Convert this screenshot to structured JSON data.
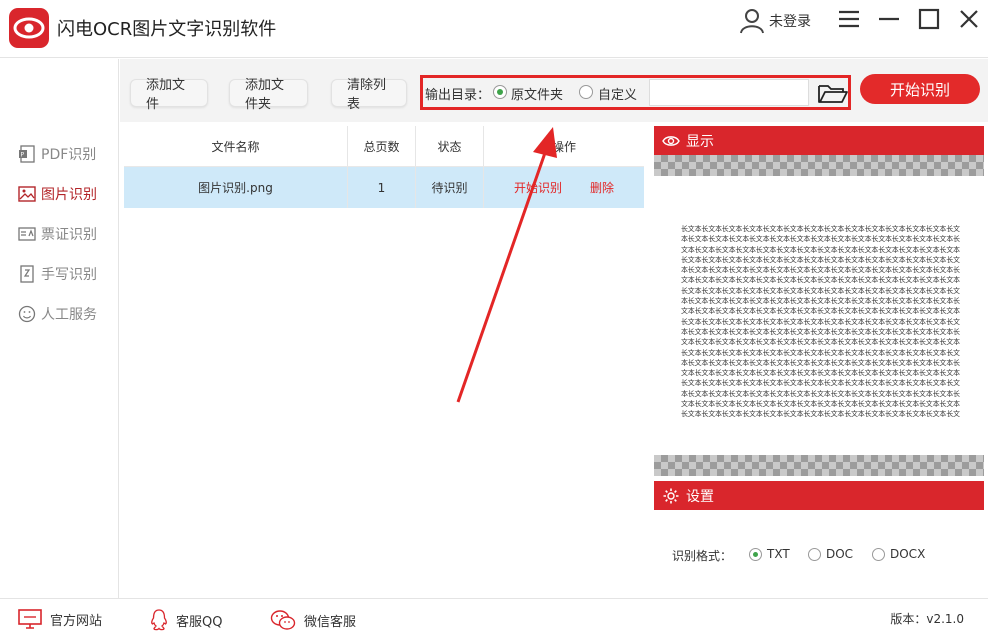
{
  "app": {
    "title": "闪电OCR图片文字识别软件",
    "user_label": "未登录"
  },
  "sidebar": {
    "items": [
      {
        "label": "PDF识别",
        "icon": "pdf-icon",
        "active": false
      },
      {
        "label": "图片识别",
        "icon": "image-icon",
        "active": true
      },
      {
        "label": "票证识别",
        "icon": "ticket-icon",
        "active": false
      },
      {
        "label": "手写识别",
        "icon": "handwrite-icon",
        "active": false
      },
      {
        "label": "人工服务",
        "icon": "smiley-icon",
        "active": false
      }
    ]
  },
  "toolbar": {
    "add_file": "添加文件",
    "add_folder": "添加文件夹",
    "clear_list": "清除列表",
    "output_label": "输出目录：",
    "option_source": "原文件夹",
    "option_custom": "自定义",
    "path_value": "",
    "start": "开始识别"
  },
  "table": {
    "headers": [
      "文件名称",
      "总页数",
      "状态",
      "操作"
    ],
    "rows": [
      {
        "name": "图片识别.png",
        "pages": "1",
        "status": "待识别",
        "action_start": "开始识别",
        "action_delete": "删除"
      }
    ]
  },
  "preview": {
    "title": "显示",
    "text": "长文本长文本长文本长文本长文本长文本长文本长文本长文本长文本长文本长文本长文本长文本长文本长文本长文本长文本长文本长文本长文本长文本长文本长文本长文本长文本长文本长文本长文本长文本长文本长文本长文本长文本长文本长文本长文本长文本长文本长文本长文本长文本长文本长文本长文本长文本长文本长文本长文本长文本长文本长文本长文本长文本长文本长文本长文本长文本长文本长文本长文本长文本长文本长文本长文本长文本长文本长文本长文本长文本长文本长文本长文本长文本长文本长文本长文本长文本长文本长文本长文本长文本长文本长文本长文本长文本长文本长文本长文本长文本长文本长文本长文本长文本长文本长文本长文本长文本长文本长文本长文本长文本长文本长文本长文本长文本长文本长文本长文本长文本长文本长文本长文本长文本长文本长文本长文本长文本长文本长文本长文本长文本长文本长文本长文本长文本长文本长文本长文本长文本长文本长文本长文本长文本长文本长文本长文本长文本长文本长文本长文本长文本长文本长文本长文本长文本长文本长文本长文本长文本长文本长文本长文本长文本长文本长文本长文本长文本长文本长文本长文本长文本长文本长文本长文本长文本长文本长文本长文本长文本长文本长文本长文本长文本长文本长文本长文本长文本长文本长文本长文本长文本长文本长文本长文本长文本长文本长文本长文本长文本长文本长文本长文本长文本长文本长文本长文本长文本长文本长文本长文本长文本长文本长文本长文本长文本长文本长文本长文本长文本长文本长文本长文本长文本长文本长文本长文本长文本长文本长文本长文本长文本长文本长文本长文本长文本长文本长文本长文本长文本长文本长文本长文本长文本长文本长文本长文本长文本长文本长文本长文本长文本长文本长文本长文本长文本长文本长文本长文本长文本长文本长文本长文本长文本长文本长文本长文本长文本长文本长文本"
  },
  "settings": {
    "title": "设置",
    "format_label": "识别格式：",
    "formats": [
      "TXT",
      "DOC",
      "DOCX"
    ],
    "selected_format": "TXT"
  },
  "footer": {
    "website": "官方网站",
    "qq": "客服QQ",
    "wechat": "微信客服",
    "version": "版本：v2.1.0"
  },
  "colors": {
    "accent": "#d9262c",
    "highlight_box": "#e32626",
    "radio_on": "#3ea34a",
    "row_selected": "#cfe9f9"
  }
}
